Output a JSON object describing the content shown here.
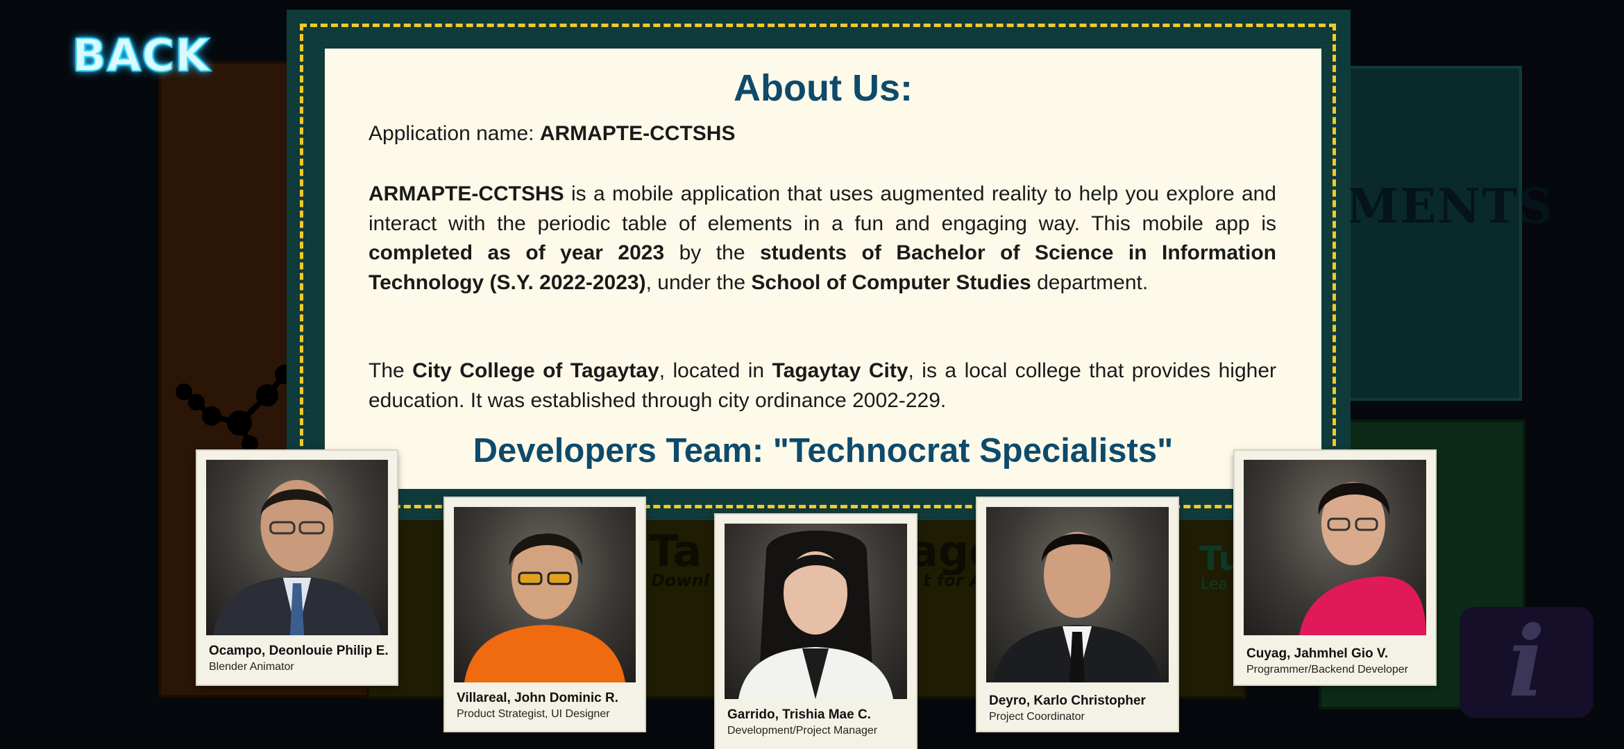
{
  "nav": {
    "back_label": "BACK"
  },
  "background": {
    "word_fragment": "MENTS",
    "game_title_a": "Ta",
    "game_title_b": "age",
    "game_sub_a": "Downl",
    "game_sub_b": "t for Al",
    "tut_a": "Tu",
    "tut_b": "Lea"
  },
  "about": {
    "title": "About Us:",
    "app_name_prefix": "Application name: ",
    "app_name": "ARMAPTE-CCTSHS",
    "desc_app": "ARMAPTE-CCTSHS",
    "desc_1": " is a mobile application that uses augmented reality to help you explore and interact with the periodic table of elements in a fun and engaging way. This mobile app is ",
    "desc_b1": "completed as of year 2023",
    "desc_2": " by the ",
    "desc_b2": "students of Bachelor of Science in Information Technology (S.Y. 2022-2023)",
    "desc_3": ", under the ",
    "desc_b3": "School of Computer Studies",
    "desc_4": " department.",
    "city_1": "The ",
    "city_b1": "City College of Tagaytay",
    "city_2": ", located in ",
    "city_b2": "Tagaytay City",
    "city_3": ", is a local college that provides higher education. It was established through city ordinance 2002-229."
  },
  "team": {
    "title": "Developers Team: \"Technocrat Specialists\"",
    "members": [
      {
        "name": "Ocampo, Deonlouie Philip E.",
        "role": "Blender Animator",
        "shirt": "#2b2e36"
      },
      {
        "name": "Villareal, John Dominic R.",
        "role": "Product Strategist, UI Designer",
        "shirt": "#f06a0f"
      },
      {
        "name": "Garrido, Trishia Mae C.",
        "role": "Development/Project Manager",
        "shirt": "#f2f2ee"
      },
      {
        "name": "Deyro, Karlo Christopher",
        "role": "Project Coordinator",
        "shirt": "#1c1d21"
      },
      {
        "name": "Cuyag, Jahmhel Gio V.",
        "role": "Programmer/Backend Developer",
        "shirt": "#e0195a"
      }
    ]
  },
  "colors": {
    "accent": "#0d4a6b",
    "frame": "#0f3a3a",
    "dash": "#f3c92a",
    "paper": "#fdfaea"
  },
  "icons": {
    "info": "info-icon"
  }
}
